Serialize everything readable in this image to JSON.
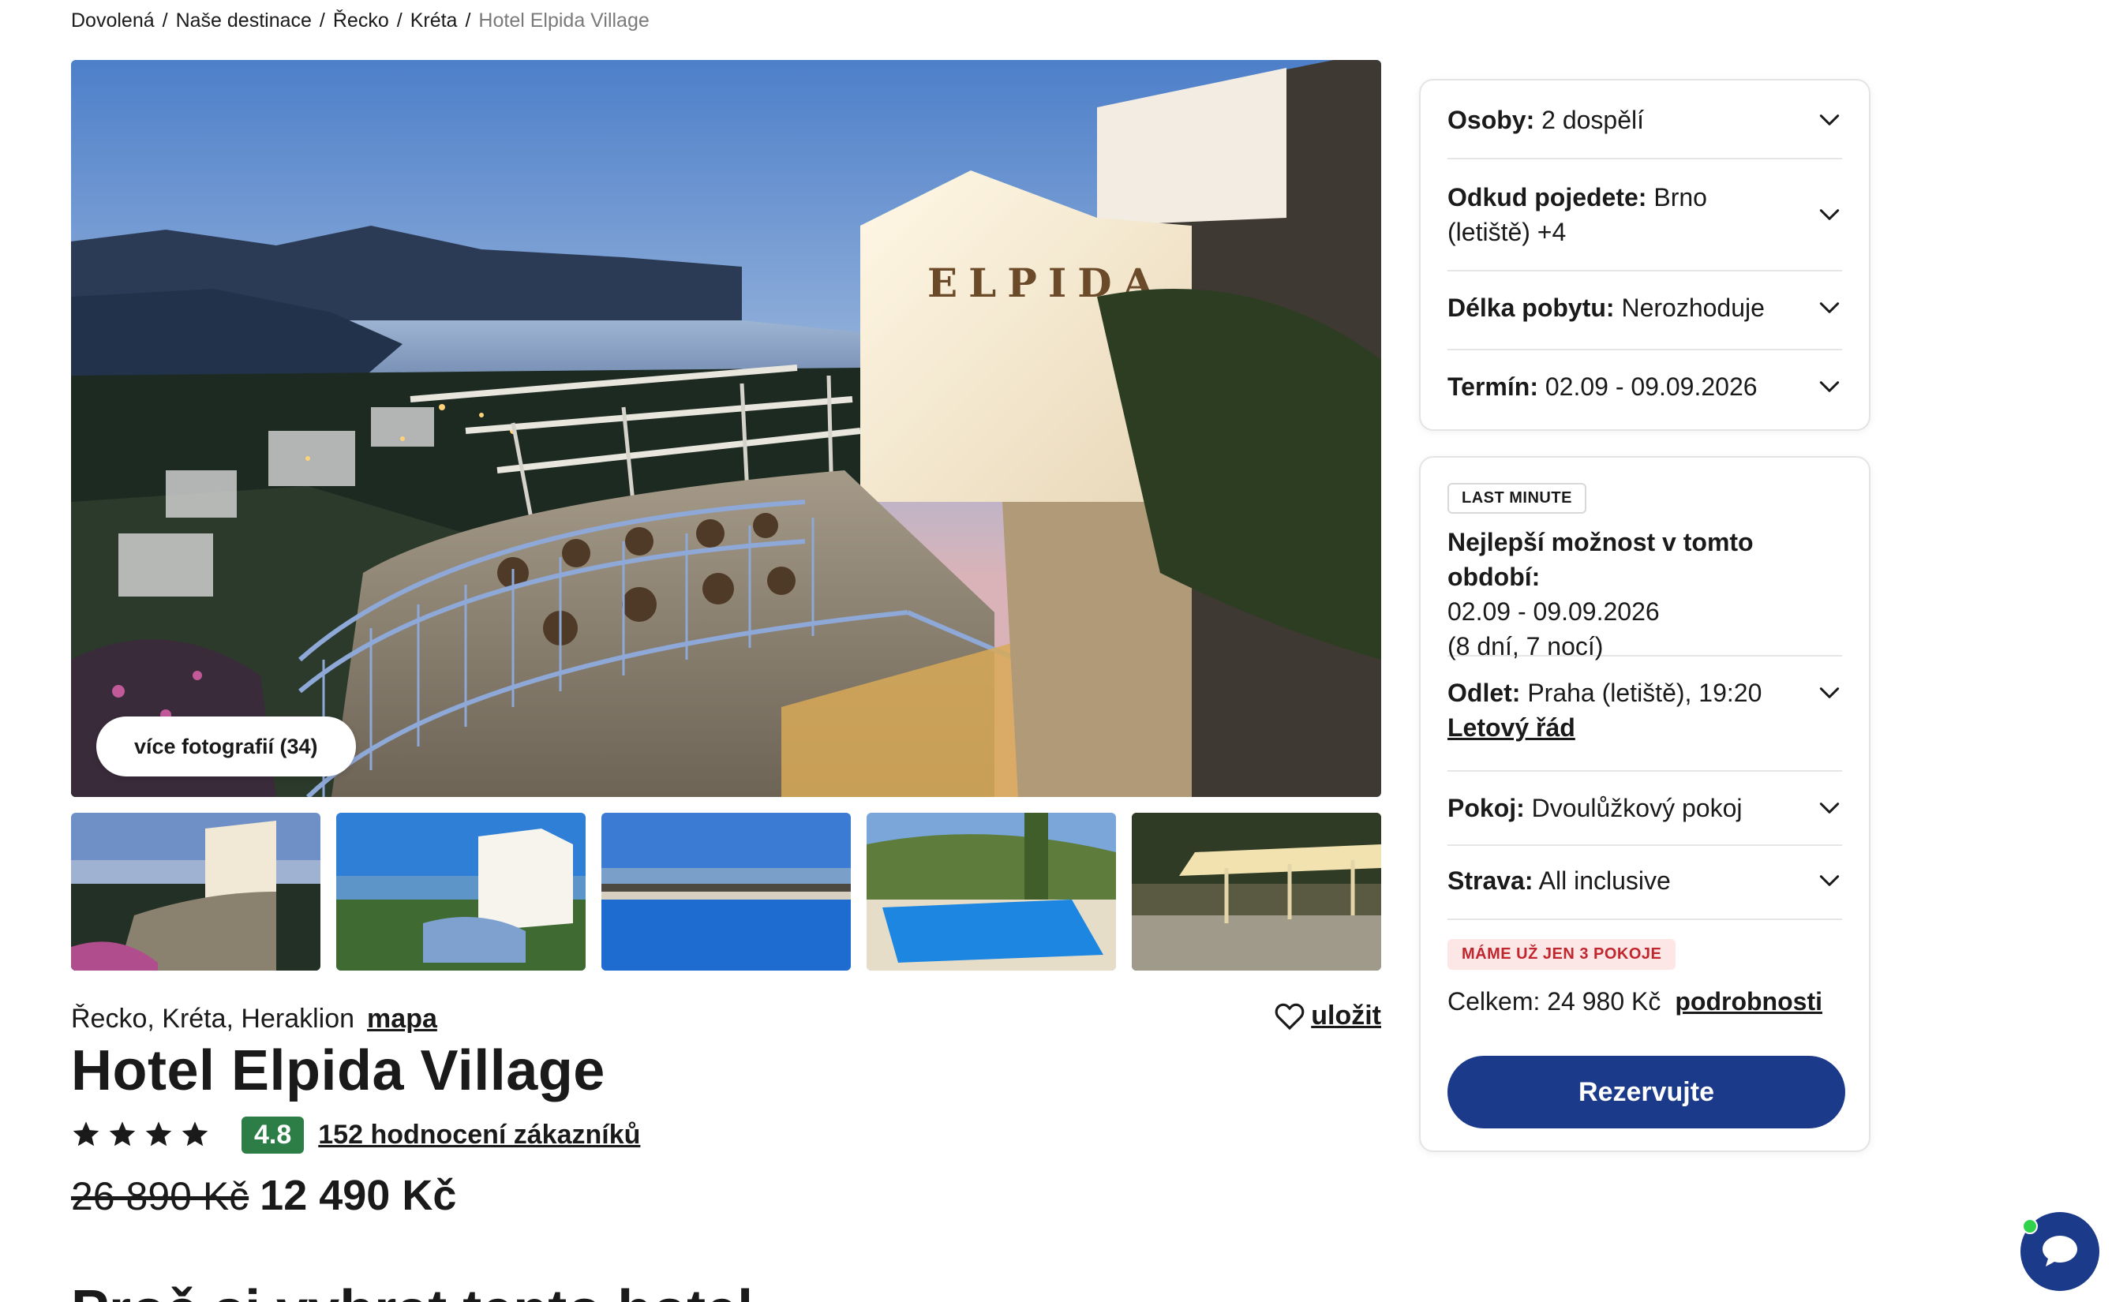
{
  "breadcrumb": {
    "items": [
      "Dovolená",
      "Naše destinace",
      "Řecko",
      "Kréta"
    ],
    "current": "Hotel Elpida Village",
    "separator": "/"
  },
  "gallery": {
    "sign_text": "ELPIDA",
    "more_photos_label": "více fotografií (34)",
    "thumbnails": [
      "terrace-evening",
      "hotel-building",
      "pool-sea-view",
      "pool-garden",
      "pergola-terrace"
    ]
  },
  "hotel": {
    "location": "Řecko, Kréta, Heraklion",
    "map_label": "mapa",
    "save_label": "uložit",
    "name": "Hotel Elpida Village",
    "stars": 4,
    "score": "4.8",
    "reviews_label": "152 hodnocení zákazníků",
    "old_price": "26 890 Kč",
    "new_price": "12 490 Kč",
    "section_heading": "Proč si vybrat tento hotel"
  },
  "filters": {
    "persons_label": "Osoby:",
    "persons_value": "2 dospělí",
    "from_label": "Odkud pojedete:",
    "from_value": "Brno",
    "from_value2": "(letiště) +4",
    "length_label": "Délka pobytu:",
    "length_value": "Nerozhoduje",
    "term_label": "Termín:",
    "term_value": "02.09 - 09.09.2026"
  },
  "offer": {
    "badge": "LAST MINUTE",
    "best_label": "Nejlepší možnost v tomto období:",
    "best_dates": "02.09 - 09.09.2026",
    "best_duration": "(8 dní, 7 nocí)",
    "departure_label": "Odlet:",
    "departure_value": "Praha (letiště), 19:20",
    "timetable_label": "Letový řád",
    "room_label": "Pokoj:",
    "room_value": "Dvoulůžkový pokoj",
    "board_label": "Strava:",
    "board_value": "All inclusive",
    "scarcity_badge": "MÁME UŽ JEN 3 POKOJE",
    "total_label": "Celkem: 24 980 Kč",
    "details_label": "podrobnosti",
    "reserve_label": "Rezervujte"
  },
  "colors": {
    "primary": "#1c3a8a",
    "score_green": "#2d7d46",
    "alert_red": "#c0262d",
    "alert_bg": "#fde6e6",
    "online_dot": "#2fd24a"
  },
  "icons": {
    "chevron": "chevron-down-icon",
    "heart": "heart-icon",
    "star": "star-icon",
    "chat": "chat-icon"
  }
}
